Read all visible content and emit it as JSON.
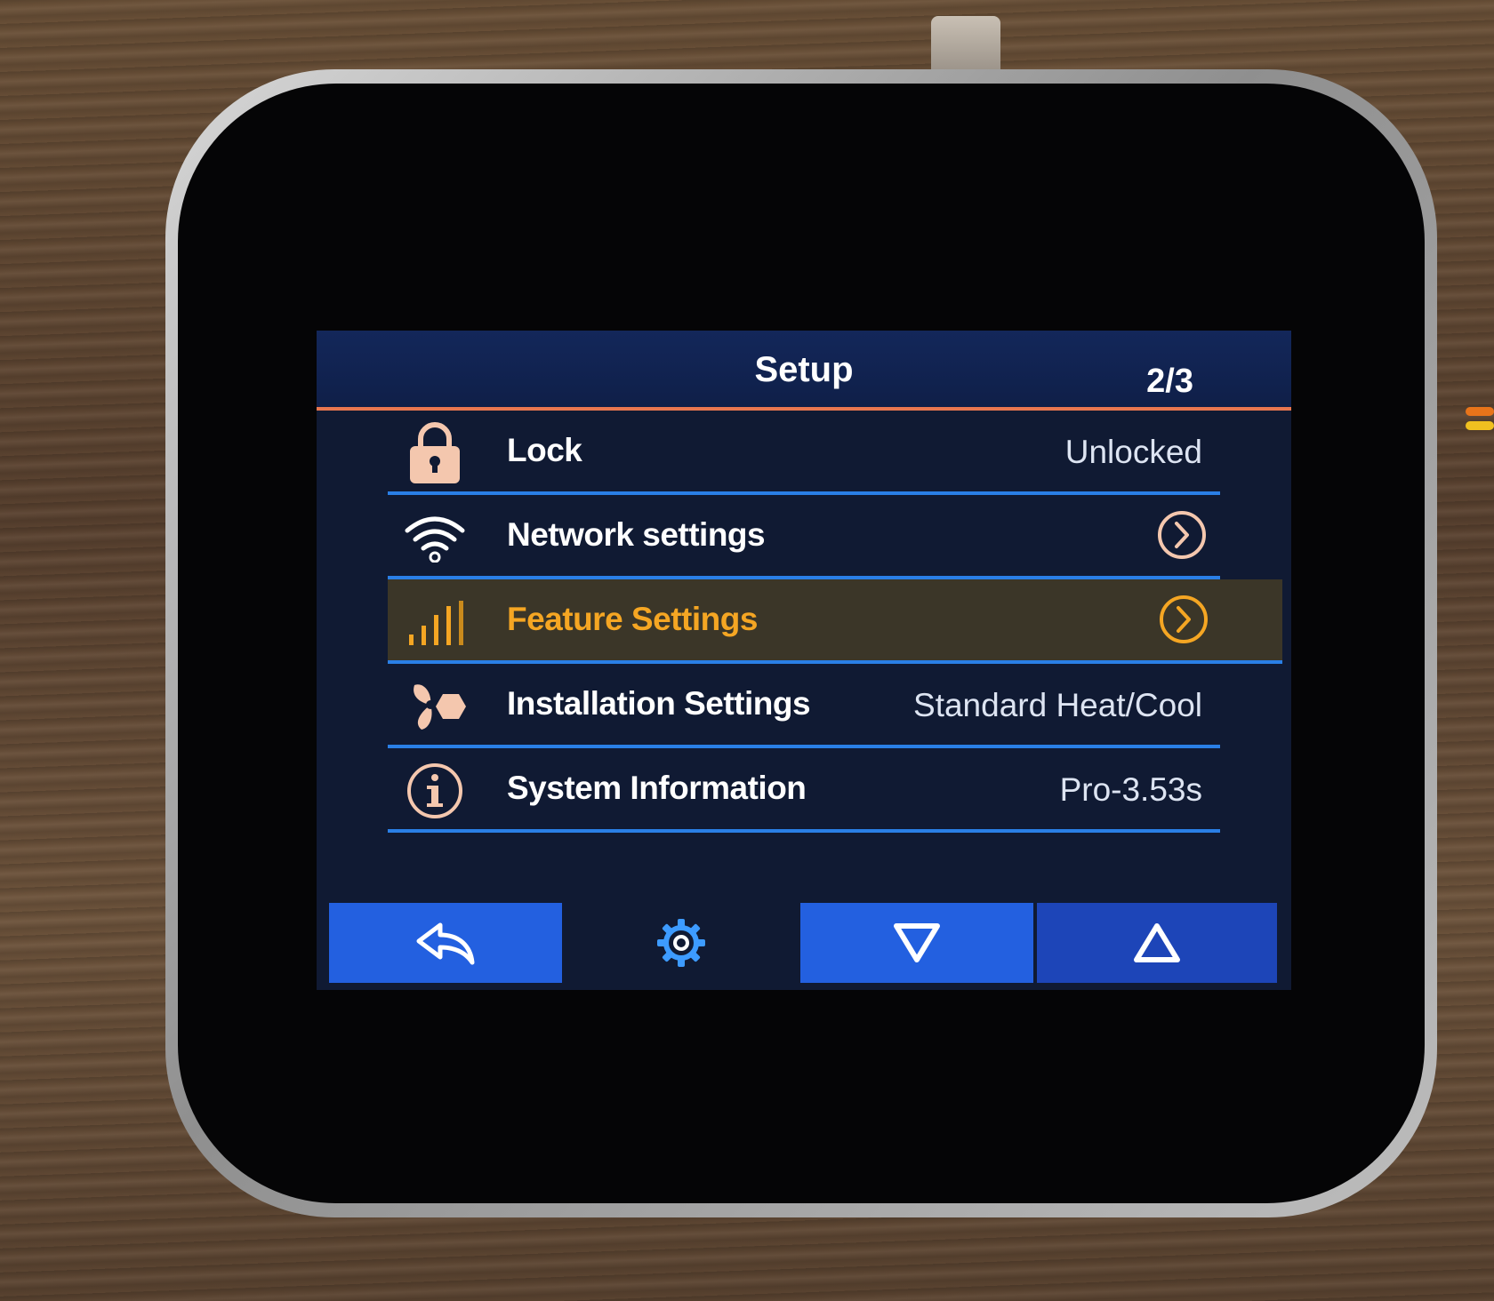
{
  "header": {
    "title": "Setup",
    "page_indicator": "2/3"
  },
  "rows": [
    {
      "label": "Lock",
      "value": "Unlocked",
      "icon": "lock-icon"
    },
    {
      "label": "Network settings",
      "value": "",
      "icon": "wifi-icon",
      "action": "chevron-right-icon"
    },
    {
      "label": "Feature Settings",
      "value": "",
      "icon": "bars-icon",
      "action": "chevron-right-icon",
      "selected": true
    },
    {
      "label": "Installation Settings",
      "value": "Standard Heat/Cool",
      "icon": "fan-icon"
    },
    {
      "label": "System Information",
      "value": "Pro-3.53s",
      "icon": "info-icon"
    }
  ],
  "footer": {
    "buttons": [
      "back-icon",
      "gear-icon",
      "down-triangle-icon",
      "up-triangle-icon"
    ]
  },
  "colors": {
    "accent_orange": "#e8774f",
    "highlight_text": "#f5a623",
    "divider_blue": "#2a7fe6",
    "button_blue": "#2360e0"
  }
}
